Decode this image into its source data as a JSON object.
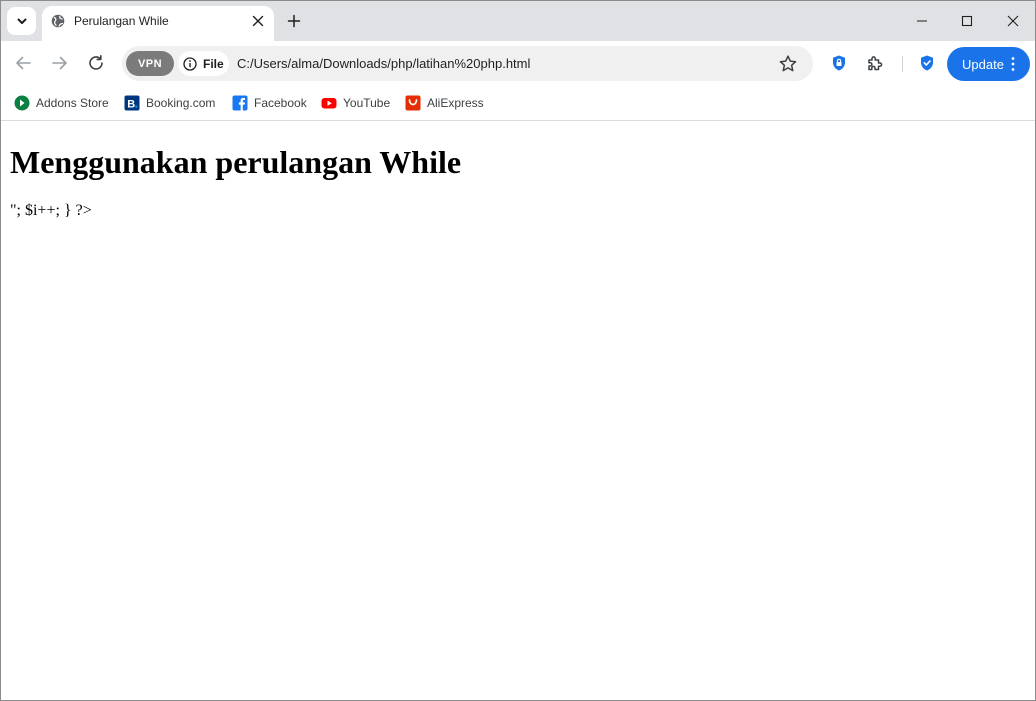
{
  "browser": {
    "tab": {
      "title": "Perulangan While"
    },
    "toolbar": {
      "vpn_label": "VPN",
      "file_label": "File",
      "url": "C:/Users/alma/Downloads/php/latihan%20php.html",
      "update_label": "Update"
    },
    "bookmarks": [
      {
        "label": "Addons Store",
        "icon": "addons-store-icon",
        "color": "#0b8043"
      },
      {
        "label": "Booking.com",
        "icon": "booking-icon",
        "color": "#003580"
      },
      {
        "label": "Facebook",
        "icon": "facebook-icon",
        "color": "#1877f2"
      },
      {
        "label": "YouTube",
        "icon": "youtube-icon",
        "color": "#ff0000"
      },
      {
        "label": "AliExpress",
        "icon": "aliexpress-icon",
        "color": "#e62e04"
      }
    ],
    "colors": {
      "accent": "#1a73e8",
      "tabstrip": "#dfe1e5"
    }
  },
  "page": {
    "heading": "Menggunakan perulangan While",
    "body_text": "\"; $i++; } ?>"
  }
}
